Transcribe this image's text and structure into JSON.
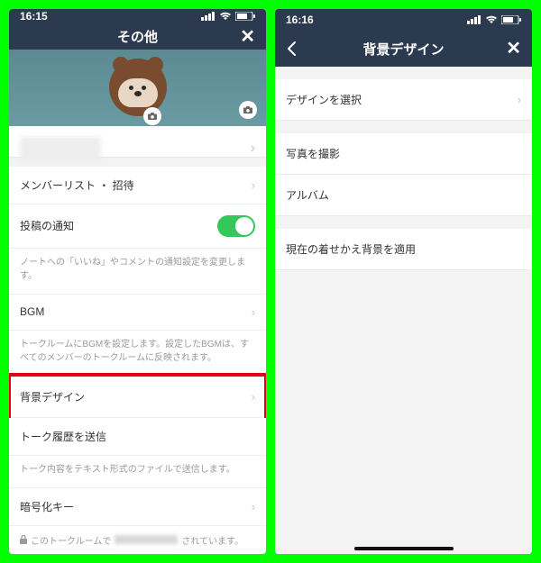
{
  "left": {
    "status_time": "16:15",
    "nav_title": "その他",
    "rows": {
      "member_list": "メンバーリスト ・ 招待",
      "post_notify": "投稿の通知",
      "post_notify_note": "ノートへの「いいね」やコメントの通知設定を変更します。",
      "bgm": "BGM",
      "bgm_note": "トークルームにBGMを設定します。設定したBGMは、すべてのメンバーのトークルームに反映されます。",
      "bg_design": "背景デザイン",
      "send_history": "トーク履歴を送信",
      "send_history_note": "トーク内容をテキスト形式のファイルで送信します。",
      "encrypt_key": "暗号化キー",
      "encrypt_note_prefix": "このトークルームで",
      "encrypt_note_suffix": "されています。"
    }
  },
  "right": {
    "status_time": "16:16",
    "nav_title": "背景デザイン",
    "rows": {
      "select_design": "デザインを選択",
      "take_photo": "写真を撮影",
      "album": "アルバム",
      "apply_current": "現在の着せかえ背景を適用"
    }
  }
}
